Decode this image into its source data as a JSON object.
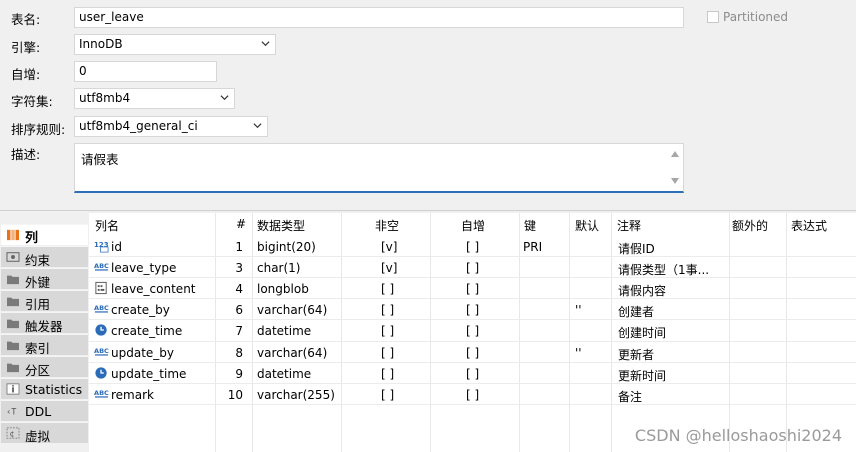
{
  "form": {
    "table_name_label": "表名:",
    "table_name_value": "user_leave",
    "engine_label": "引擎:",
    "engine_value": "InnoDB",
    "auto_inc_label": "自增:",
    "auto_inc_value": "0",
    "charset_label": "字符集:",
    "charset_value": "utf8mb4",
    "collation_label": "排序规则:",
    "collation_value": "utf8mb4_general_ci",
    "desc_label": "描述:",
    "desc_value": "请假表",
    "partitioned_label": "Partitioned"
  },
  "tabs": [
    {
      "label": "列",
      "icon": "columns-icon",
      "active": true
    },
    {
      "label": "约束",
      "icon": "constraint-icon",
      "active": false
    },
    {
      "label": "外键",
      "icon": "folder-icon",
      "active": false
    },
    {
      "label": "引用",
      "icon": "folder-icon",
      "active": false
    },
    {
      "label": "触发器",
      "icon": "folder-icon",
      "active": false
    },
    {
      "label": "索引",
      "icon": "folder-icon",
      "active": false
    },
    {
      "label": "分区",
      "icon": "folder-icon",
      "active": false
    },
    {
      "label": "Statistics",
      "icon": "info-icon",
      "active": false
    },
    {
      "label": "DDL",
      "icon": "ddl-icon",
      "active": false
    },
    {
      "label": "虚拟",
      "icon": "virtual-icon",
      "active": false
    }
  ],
  "columns": {
    "headers": [
      "列名",
      "#",
      "数据类型",
      "非空",
      "自增",
      "键",
      "默认",
      "注释",
      "额外的",
      "表达式"
    ],
    "rows": [
      {
        "icon": "number-type-icon",
        "name": "id",
        "num": "1",
        "type": "bigint(20)",
        "notnull": "[v]",
        "autoinc": "[ ]",
        "key": "PRI",
        "default": "",
        "comment": "请假ID"
      },
      {
        "icon": "text-type-icon",
        "name": "leave_type",
        "num": "3",
        "type": "char(1)",
        "notnull": "[v]",
        "autoinc": "[ ]",
        "key": "",
        "default": "",
        "comment": "请假类型（1事..."
      },
      {
        "icon": "blob-type-icon",
        "name": "leave_content",
        "num": "4",
        "type": "longblob",
        "notnull": "[ ]",
        "autoinc": "[ ]",
        "key": "",
        "default": "",
        "comment": "请假内容"
      },
      {
        "icon": "text-type-icon",
        "name": "create_by",
        "num": "6",
        "type": "varchar(64)",
        "notnull": "[ ]",
        "autoinc": "[ ]",
        "key": "",
        "default": "''",
        "comment": "创建者"
      },
      {
        "icon": "datetime-type-icon",
        "name": "create_time",
        "num": "7",
        "type": "datetime",
        "notnull": "[ ]",
        "autoinc": "[ ]",
        "key": "",
        "default": "",
        "comment": "创建时间"
      },
      {
        "icon": "text-type-icon",
        "name": "update_by",
        "num": "8",
        "type": "varchar(64)",
        "notnull": "[ ]",
        "autoinc": "[ ]",
        "key": "",
        "default": "''",
        "comment": "更新者"
      },
      {
        "icon": "datetime-type-icon",
        "name": "update_time",
        "num": "9",
        "type": "datetime",
        "notnull": "[ ]",
        "autoinc": "[ ]",
        "key": "",
        "default": "",
        "comment": "更新时间"
      },
      {
        "icon": "text-type-icon",
        "name": "remark",
        "num": "10",
        "type": "varchar(255)",
        "notnull": "[ ]",
        "autoinc": "[ ]",
        "key": "",
        "default": "",
        "comment": "备注"
      }
    ]
  },
  "watermark": "CSDN @helloshaoshi2024",
  "colors": {
    "accent": "#2f6fb7",
    "active_tab_icon": "#e8731a",
    "folder": "#7a7a7a"
  }
}
